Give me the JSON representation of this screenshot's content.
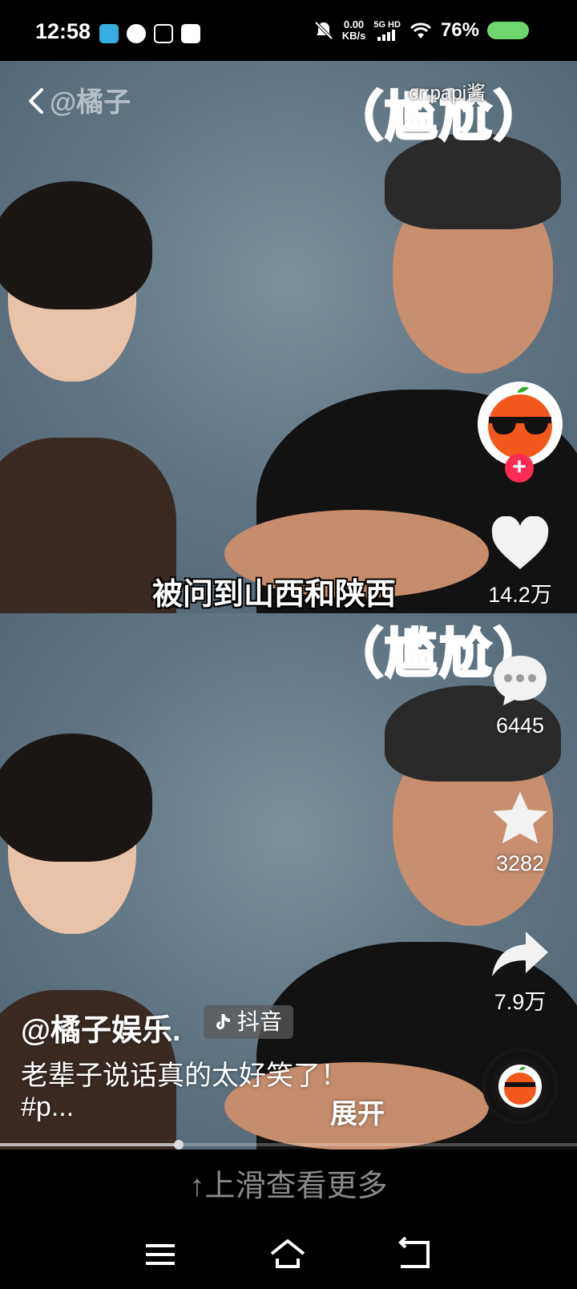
{
  "status_bar": {
    "time": "12:58",
    "net_speed_value": "0.00",
    "net_speed_unit": "KB/s",
    "signal_label": "5G HD",
    "battery": "76%",
    "battery_level": 0.76,
    "battery_color": "#6fd56d"
  },
  "video": {
    "watermark_account": "@橘子",
    "watermark_credit": "cr:papi酱",
    "overlay_top": "（尴尬）",
    "overlay_bottom": "（尴尬）",
    "subtitle": "被问到山西和陕西"
  },
  "rail": {
    "follow_symbol": "+",
    "like_count": "14.2万",
    "comment_count": "6445",
    "favorite_count": "3282",
    "share_count": "7.9万",
    "like_color": "#ffffff",
    "follow_color": "#fe2c55"
  },
  "caption": {
    "author": "@橘子娱乐.",
    "badge": "抖音",
    "description": "老辈子说话真的太好笑了！",
    "hashtag": "#p...",
    "expand": "展开"
  },
  "progress": {
    "played_fraction": 0.31
  },
  "footer": {
    "swipe_hint": "↑上滑查看更多"
  }
}
